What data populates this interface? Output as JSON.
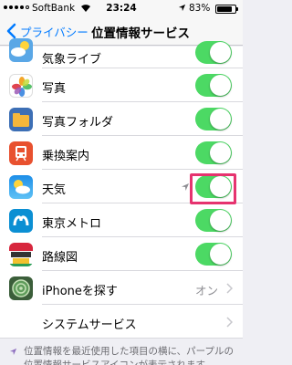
{
  "status_bar": {
    "carrier": "SoftBank",
    "time": "23:24",
    "battery_pct": "83%",
    "battery_level": 0.83
  },
  "nav": {
    "back_label": "プライバシー",
    "title": "位置情報サービス"
  },
  "rows": [
    {
      "label": "気象ライブ",
      "icon": "weather-live-icon",
      "on": true
    },
    {
      "label": "写真",
      "icon": "photos-icon",
      "on": true
    },
    {
      "label": "写真フォルダ",
      "icon": "photo-folder-icon",
      "on": true
    },
    {
      "label": "乗換案内",
      "icon": "transit-icon",
      "on": true
    },
    {
      "label": "天気",
      "icon": "weather-icon",
      "on": true,
      "recently_used": true,
      "highlighted": true
    },
    {
      "label": "東京メトロ",
      "icon": "tokyo-metro-icon",
      "on": true
    },
    {
      "label": "路線図",
      "icon": "railway-map-icon",
      "on": true
    },
    {
      "label": "iPhoneを探す",
      "icon": "find-iphone-icon",
      "detail": "オン"
    },
    {
      "label": "システムサービス"
    }
  ],
  "footer": {
    "text": "位置情報を最近使用した項目の横に、パープルの位置情報サービスアイコンが表示されます。"
  },
  "colors": {
    "accent": "#007aff",
    "toggle_on": "#4cd964",
    "highlight": "#e6336f",
    "location_purple": "#8e6fbf"
  }
}
